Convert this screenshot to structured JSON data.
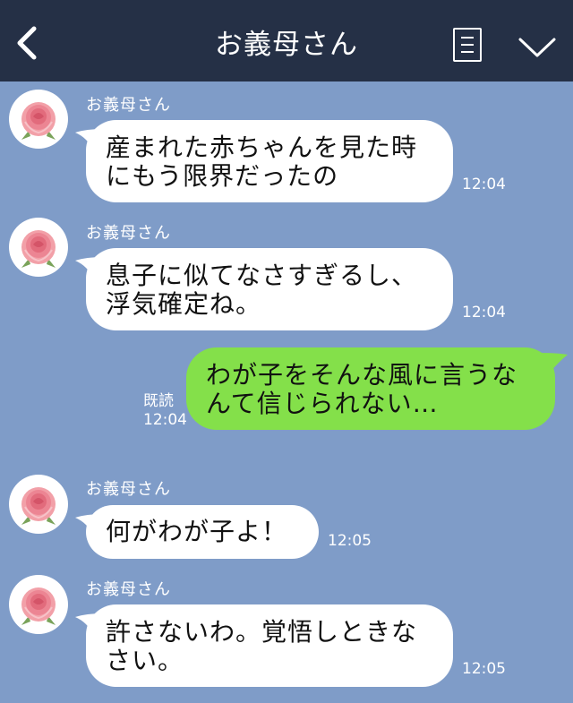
{
  "header": {
    "title": "お義母さん",
    "back_icon": "chevron-left-icon",
    "menu_icon": "note-menu-icon",
    "collapse_icon": "chevron-down-icon",
    "bg_color": "#253046"
  },
  "chat_bg_color": "#7f9cc8",
  "messages": [
    {
      "sender": "お義母さん",
      "text_lines": [
        "産まれた赤ちゃんを見た時",
        "にもう限界だったの"
      ],
      "time": "12:04"
    },
    {
      "sender": "お義母さん",
      "text_lines": [
        "息子に似てなさすぎるし、",
        "浮気確定ね。"
      ],
      "time": "12:04"
    },
    {
      "mine": true,
      "text_lines": [
        "わが子をそんな風に言うな",
        "んて信じられない…"
      ],
      "read": "既読",
      "time": "12:04",
      "bubble_color": "#84e04a"
    },
    {
      "sender": "お義母さん",
      "text_lines": [
        "何がわが子よ！"
      ],
      "time": "12:05"
    },
    {
      "sender": "お義母さん",
      "text_lines": [
        "許さないわ。覚悟しときな",
        "さい。"
      ],
      "time": "12:05"
    }
  ]
}
